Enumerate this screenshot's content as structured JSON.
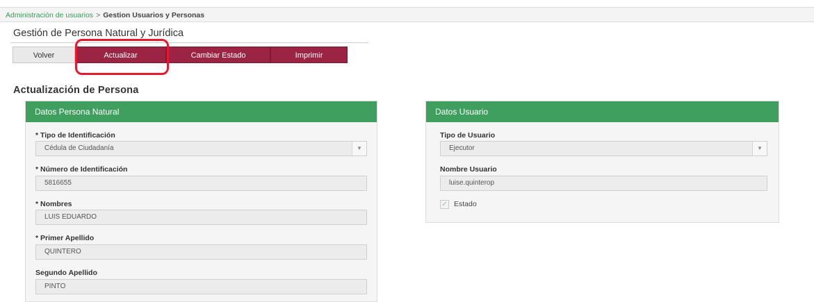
{
  "breadcrumb": {
    "parent": "Administración de usuarios",
    "separator": ">",
    "current": "Gestion Usuarios y Personas"
  },
  "page_title": "Gestión de Persona Natural y Jurídica",
  "toolbar": {
    "volver": "Volver",
    "actualizar": "Actualizar",
    "cambiar_estado": "Cambiar Estado",
    "imprimir": "Imprimir"
  },
  "section_title": "Actualización de Persona",
  "persona_natural": {
    "header": "Datos Persona Natural",
    "tipo_identificacion": {
      "label": "* Tipo de Identificación",
      "value": "Cédula de Ciudadanía"
    },
    "numero_identificacion": {
      "label": "* Número de Identificación",
      "value": "5816655"
    },
    "nombres": {
      "label": "* Nombres",
      "value": "LUIS EDUARDO"
    },
    "primer_apellido": {
      "label": "* Primer Apellido",
      "value": "QUINTERO"
    },
    "segundo_apellido": {
      "label": "Segundo Apellido",
      "value": "PINTO"
    }
  },
  "usuario": {
    "header": "Datos Usuario",
    "tipo_usuario": {
      "label": "Tipo de Usuario",
      "value": "Ejecutor"
    },
    "nombre_usuario": {
      "label": "Nombre Usuario",
      "value": "luise.quinterop"
    },
    "estado": {
      "label": "Estado",
      "checked": true
    }
  },
  "colors": {
    "primary_green": "#3e9f5e",
    "button_maroon": "#9b2343",
    "highlight_red": "#e8192c",
    "link_green": "#3c9b5a"
  },
  "icons": {
    "select_arrow": "chevron-down-icon",
    "check": "check-icon"
  }
}
